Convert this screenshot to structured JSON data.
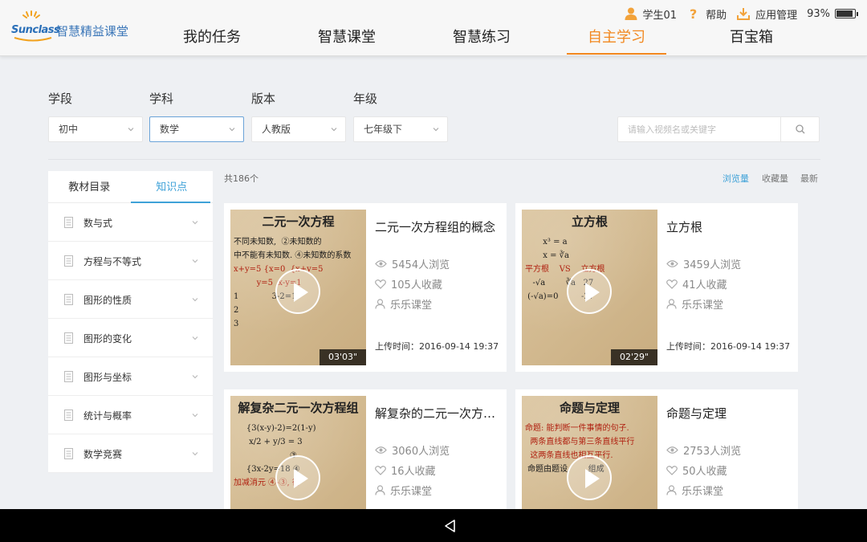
{
  "header": {
    "brand": "Sunclass",
    "brand_cn": "智慧精益课堂",
    "user": "学生01",
    "help": "帮助",
    "app_manage": "应用管理",
    "battery": "93%",
    "battery_level": 0.93,
    "tabs": [
      {
        "label": "我的任务"
      },
      {
        "label": "智慧课堂"
      },
      {
        "label": "智慧练习"
      },
      {
        "label": "自主学习",
        "active": true
      },
      {
        "label": "百宝箱"
      }
    ]
  },
  "filters": {
    "labels": [
      "学段",
      "学科",
      "版本",
      "年级"
    ],
    "values": [
      "初中",
      "数学",
      "人教版",
      "七年级下"
    ],
    "search_placeholder": "请输入视频名或关键字"
  },
  "sidebar": {
    "tabs": [
      "教材目录",
      "知识点"
    ],
    "active_tab": "知识点",
    "items": [
      "数与式",
      "方程与不等式",
      "图形的性质",
      "图形的变化",
      "图形与坐标",
      "统计与概率",
      "数学竞赛"
    ]
  },
  "results": {
    "count": "共186个",
    "sort": [
      "浏览量",
      "收藏量",
      "最新"
    ],
    "active_sort": "浏览量"
  },
  "videos": [
    {
      "title": "二元一次方程组的概念",
      "thumb_title": "二元一次方程",
      "views": "5454人浏览",
      "favorites": "105人收藏",
      "author": "乐乐课堂",
      "upload": "上传时间：2016-09-14 19:37",
      "duration": "03'03\""
    },
    {
      "title": "立方根",
      "thumb_title": "立方根",
      "views": "3459人浏览",
      "favorites": "41人收藏",
      "author": "乐乐课堂",
      "upload": "上传时间：2016-09-14 19:37",
      "duration": "02'29\""
    },
    {
      "title": "解复杂的二元一次方程组",
      "thumb_title": "解复杂二元一次方程组",
      "views": "3060人浏览",
      "favorites": "16人收藏",
      "author": "乐乐课堂",
      "upload": "",
      "duration": ""
    },
    {
      "title": "命题与定理",
      "thumb_title": "命题与定理",
      "views": "2753人浏览",
      "favorites": "50人收藏",
      "author": "乐乐课堂",
      "upload": "",
      "duration": ""
    }
  ],
  "icons": {
    "user": "user-icon",
    "help": "help-icon",
    "download": "download-icon",
    "search": "search-icon",
    "eye": "eye-icon",
    "heart": "heart-icon",
    "person": "person-icon",
    "doc": "document-icon",
    "back": "back-triangle-icon"
  },
  "colors": {
    "accent_orange": "#f2871e",
    "accent_blue": "#3fa2d8",
    "brand_blue": "#2a6fb8"
  }
}
